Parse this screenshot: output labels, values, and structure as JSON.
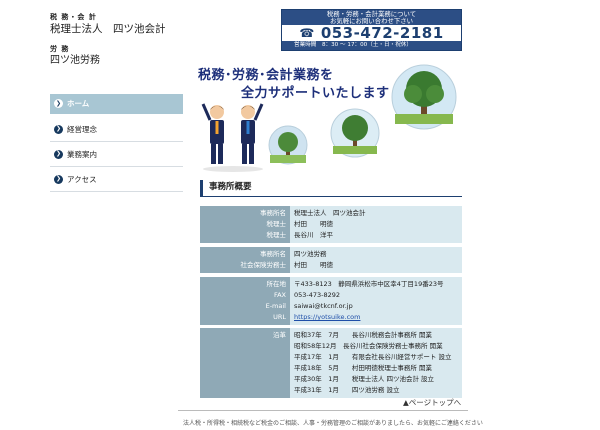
{
  "header": {
    "cat1": "税 務・会 計",
    "name1": "税理士法人　四ツ池会計",
    "cat2": "労 務",
    "name2": "四ツ池労務"
  },
  "contact": {
    "line1": "税務・労務・会計業務について",
    "line2": "お気軽にお問い合わせ下さい",
    "tel": "053-472-2181",
    "hours": "営業時間　8：30 ～ 17：00（土・日・祝休）"
  },
  "nav": {
    "items": [
      {
        "label": "ホーム"
      },
      {
        "label": "経営理念"
      },
      {
        "label": "業務案内"
      },
      {
        "label": "アクセス"
      }
    ]
  },
  "hero": {
    "line1": "税務･労務･会計業務を",
    "line2": "全力サポートいたします"
  },
  "section": {
    "title": "事務所概要"
  },
  "blocks": [
    {
      "rows": [
        {
          "label": "事務所名",
          "value": "税理士法人　四ツ池会計"
        },
        {
          "label": "税理士",
          "value": "村田　　明徳"
        },
        {
          "label": "税理士",
          "value": "長谷川　洋平"
        }
      ]
    },
    {
      "rows": [
        {
          "label": "事務所名",
          "value": "四ツ池労務"
        },
        {
          "label": "社会保険労務士",
          "value": "村田　　明徳"
        }
      ]
    },
    {
      "rows": [
        {
          "label": "所在地",
          "value": "〒433-8123　静岡県浜松市中区幸4丁目19番23号"
        },
        {
          "label": "FAX",
          "value": "053-473-8292"
        },
        {
          "label": "E-mail",
          "value": "saiwai@tkcnf.or.jp"
        },
        {
          "label": "URL",
          "value": "https://yotsuike.com"
        }
      ]
    },
    {
      "rows": [
        {
          "label": "沿革",
          "value": "昭和37年　7月　　長谷川税務会計事務所 開業"
        },
        {
          "label": "",
          "value": "昭和58年12月　長谷川社会保険労務士事務所 開業"
        },
        {
          "label": "",
          "value": "平成17年　1月　　有限会社長谷川経営サポート 設立"
        },
        {
          "label": "",
          "value": "平成18年　5月　　村田明徳税理士事務所 開業"
        },
        {
          "label": "",
          "value": "平成30年　1月　　税理士法人 四ツ池会計 設立"
        },
        {
          "label": "",
          "value": "平成31年　1月　　四ツ池労務 設立"
        }
      ]
    }
  ],
  "pagetop": "▲ページトップへ",
  "footer": "法人税・所得税・相続税など税金のご相談、人事・労務管理のご相談がありましたら、お気軽にご連絡ください",
  "colors": {
    "navy": "#1d3f70",
    "nav_active": "#a8c6d3",
    "label_bg": "#8fa9b6",
    "value_bg": "#d9e9ef",
    "hero_text": "#1d2f7a"
  }
}
